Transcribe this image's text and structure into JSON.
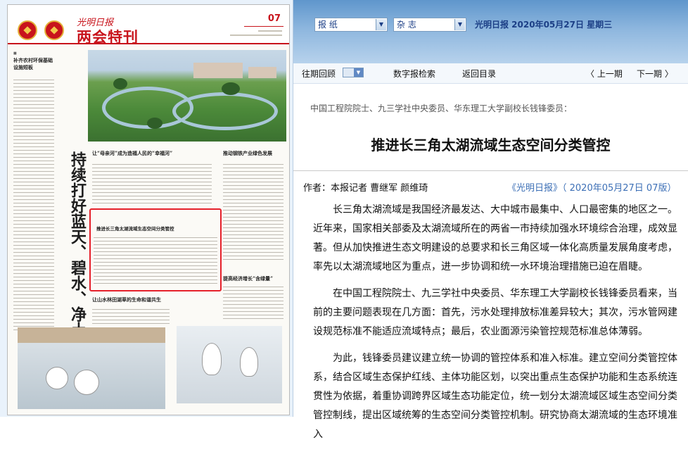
{
  "paper": {
    "logo_text": "光明日报",
    "banner_title": "两会特刊",
    "page_number": "07",
    "vertical_title": "持续打好蓝天、碧水、净土保卫战",
    "headlines": [
      "补齐农村环保基础设施短板",
      "让“母亲河”成为造福人民的“幸福河”",
      "推动钢铁产业绿色发展",
      "推进长三角太湖流域生态空间分类管控",
      "提高经济增长“含绿量”",
      "让山水林田湖草的生命和谐共生"
    ]
  },
  "toolbar": {
    "select_newspaper": "报  纸",
    "select_magazine": "杂  志",
    "date_text": "光明日报  2020年05月27日  星期三"
  },
  "nav": {
    "archive": "往期回顾",
    "digital_search": "数字报检索",
    "back_to_index": "返回目录",
    "prev_issue": "〈 上一期",
    "next_issue": "下一期 〉"
  },
  "article": {
    "subhead": "中国工程院院士、九三学社中央委员、华东理工大学副校长钱锋委员：",
    "title": "推进长三角太湖流域生态空间分类管控",
    "byline": "作者：本报记者  曹继军  颜维琦",
    "source": "《光明日报》（ 2020年05月27日   07版）",
    "paragraphs": [
      "长三角太湖流域是我国经济最发达、大中城市最集中、人口最密集的地区之一。近年来，国家相关部委及太湖流域所在的两省一市持续加强水环境综合治理，成效显著。但从加快推进生态文明建设的总要求和长三角区域一体化高质量发展角度考虑，率先以太湖流域地区为重点，进一步协调和统一水环境治理措施已迫在眉睫。",
      "在中国工程院院士、九三学社中央委员、华东理工大学副校长钱锋委员看来，当前的主要问题表现在几方面：首先，污水处理排放标准差异较大；其次，污水管网建设规范标准不能适应流域特点；最后，农业面源污染管控规范标准总体薄弱。",
      "为此，钱锋委员建议建立统一协调的管控体系和准入标准。建立空间分类管控体系，结合区域生态保护红线、主体功能区划，以突出重点生态保护功能和生态系统连贯性为依据，着重协调跨界区域生态功能定位，统一划分太湖流域区域生态空间分类管控制线，提出区域统筹的生态空间分类管控机制。研究协商太湖流域的生态环境准入"
    ]
  },
  "colors": {
    "accent_red": "#c8141c",
    "toolbar_blue": "#5f96cc",
    "link_blue": "#3c6fb6"
  }
}
